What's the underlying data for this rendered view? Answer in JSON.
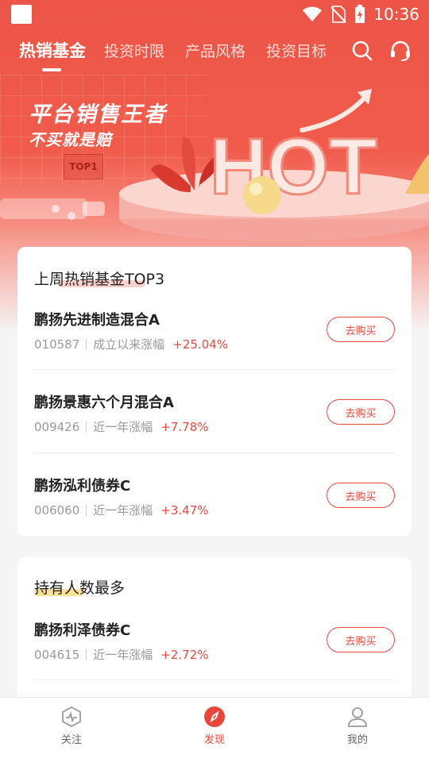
{
  "status_bar": {
    "time": "10:36"
  },
  "nav": {
    "tabs": [
      {
        "label": "热销基金",
        "active": true
      },
      {
        "label": "投资时限",
        "active": false
      },
      {
        "label": "产品风格",
        "active": false
      },
      {
        "label": "投资目标",
        "active": false
      }
    ],
    "icons": [
      "search-icon",
      "headset-icon"
    ]
  },
  "banner": {
    "title": "平台销售王者",
    "subtitle": "不买就是赔",
    "badge": "TOP1",
    "hot_text": "HOT"
  },
  "top3": {
    "title": "上周热销基金TOP3",
    "items": [
      {
        "name": "鹏扬先进制造混合A",
        "code": "010587",
        "period": "成立以来涨幅",
        "change": "+25.04%",
        "button": "去购买"
      },
      {
        "name": "鹏扬景惠六个月混合A",
        "code": "009426",
        "period": "近一年涨幅",
        "change": "+7.78%",
        "button": "去购买"
      },
      {
        "name": "鹏扬泓利债券C",
        "code": "006060",
        "period": "近一年涨幅",
        "change": "+3.47%",
        "button": "去购买"
      }
    ]
  },
  "most_held": {
    "title": "持有人数最多",
    "items": [
      {
        "name": "鹏扬利泽债券C",
        "code": "004615",
        "period": "近一年涨幅",
        "change": "+2.72%",
        "button": "去购买"
      }
    ]
  },
  "bottom_nav": [
    {
      "label": "关注",
      "icon": "heartbeat-icon",
      "active": false
    },
    {
      "label": "发现",
      "icon": "compass-icon",
      "active": true
    },
    {
      "label": "我的",
      "icon": "user-icon",
      "active": false
    }
  ],
  "colors": {
    "brand_red": "#e8483c",
    "header_red": "#ec5547"
  }
}
